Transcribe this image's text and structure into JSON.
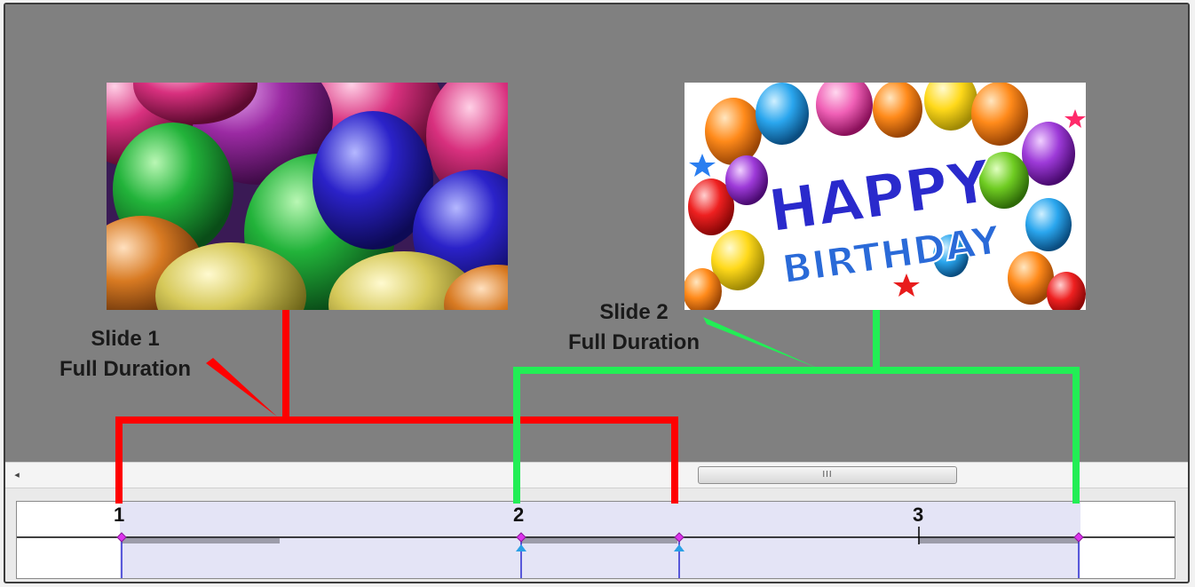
{
  "slides": [
    {
      "name": "Slide 1",
      "duration_label": "Full Duration",
      "image": "balloons-photo",
      "bracket_color": "#ff0000"
    },
    {
      "name": "Slide 2",
      "duration_label": "Full Duration",
      "image": "happy-birthday-balloons",
      "bracket_color": "#22ee55"
    }
  ],
  "birthday_image": {
    "line1": "HAPPY",
    "line2": "BIRTHDAY"
  },
  "scrollbar": {
    "left_arrow": "◂",
    "thumb_grip": "III"
  },
  "timeline": {
    "markers": [
      "1",
      "2",
      "3"
    ]
  },
  "colors": {
    "stage": "#808080",
    "timeline_band": "#e4e4f6",
    "keyframe": "#dd33ee",
    "track_line": "#000000",
    "transition_arrow": "#2aa0e6"
  }
}
